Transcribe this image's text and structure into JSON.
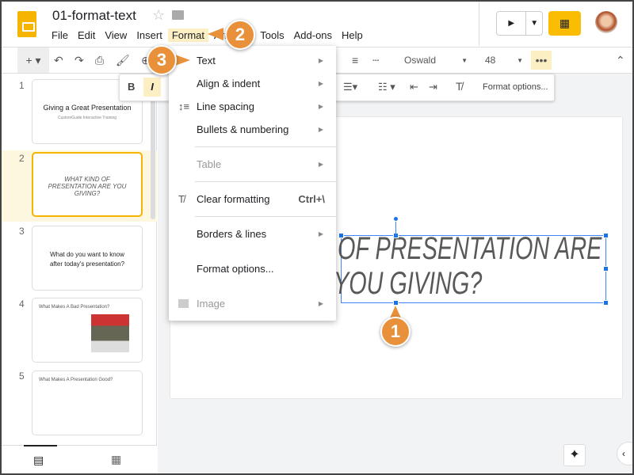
{
  "doc": {
    "title": "01-format-text"
  },
  "menubar": [
    "File",
    "Edit",
    "View",
    "Insert",
    "Format",
    "Arrange",
    "Tools",
    "Add-ons",
    "Help"
  ],
  "toolbar": {
    "font": "Oswald",
    "size": "48"
  },
  "format_bar": {
    "bold": "B",
    "italic": "I",
    "format_options": "Format options..."
  },
  "format_menu": [
    {
      "label": "Text",
      "submenu": true
    },
    {
      "label": "Align & indent",
      "submenu": true
    },
    {
      "label": "Line spacing",
      "submenu": true
    },
    {
      "label": "Bullets & numbering",
      "submenu": true
    },
    {
      "label": "Table",
      "submenu": true,
      "disabled": true
    },
    {
      "label": "Clear formatting",
      "shortcut": "Ctrl+\\"
    },
    {
      "label": "Borders & lines",
      "submenu": true
    },
    {
      "label": "Format options..."
    },
    {
      "label": "Image",
      "submenu": true,
      "disabled": true
    }
  ],
  "slides": [
    {
      "num": "1",
      "title": "Giving a Great Presentation",
      "subtitle": "CustomGuide Interactive Training"
    },
    {
      "num": "2",
      "title": "WHAT KIND OF PRESENTATION ARE YOU GIVING?"
    },
    {
      "num": "3",
      "title": "What do you want to know after today's presentation?"
    },
    {
      "num": "4",
      "title": "What Makes A Bad Presentation?"
    },
    {
      "num": "5",
      "title": "What Makes A Presentation Good?"
    }
  ],
  "slide_text": {
    "line1": "OF PRESENTATION ARE",
    "line2": "YOU GIVING?"
  },
  "callouts": [
    "1",
    "2",
    "3"
  ],
  "colors": {
    "accent": "#f4b400",
    "callout": "#e8913a",
    "selection": "#1a73e8"
  }
}
